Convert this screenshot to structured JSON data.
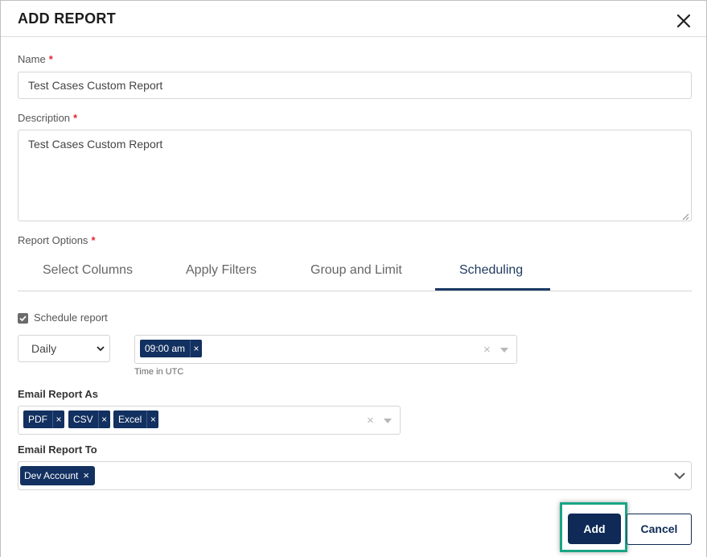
{
  "dialog": {
    "title": "ADD REPORT"
  },
  "name": {
    "label": "Name",
    "required": "*",
    "value": "Test Cases Custom Report"
  },
  "description": {
    "label": "Description",
    "required": "*",
    "value": "Test Cases Custom Report"
  },
  "report_options": {
    "label": "Report Options",
    "required": "*",
    "tabs": [
      "Select Columns",
      "Apply Filters",
      "Group and Limit",
      "Scheduling"
    ],
    "active_tab": "Scheduling"
  },
  "scheduling": {
    "checkbox_label": "Schedule report",
    "checked": true,
    "frequency": "Daily",
    "times": [
      "09:00 am"
    ],
    "time_hint": "Time in UTC"
  },
  "email_as": {
    "label": "Email Report As",
    "formats": [
      "PDF",
      "CSV",
      "Excel"
    ]
  },
  "email_to": {
    "label": "Email Report To",
    "recipients": [
      "Dev Account"
    ]
  },
  "buttons": {
    "add": "Add",
    "cancel": "Cancel"
  },
  "chip_remove": "×",
  "clear_symbol": "×",
  "colors": {
    "primary": "#0f2a57",
    "highlight": "#1aa585",
    "required": "#e0242e"
  },
  "icons": [
    "close-icon",
    "check-icon",
    "chevron-down-icon",
    "caret-down-icon"
  ]
}
